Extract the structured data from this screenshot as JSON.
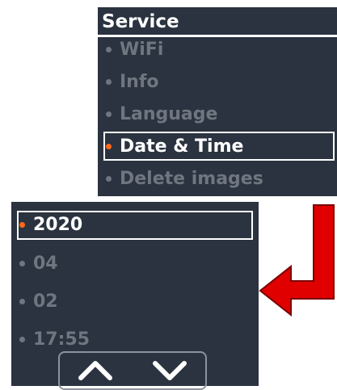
{
  "top_menu": {
    "title": "Service",
    "items": [
      {
        "label": "WiFi",
        "selected": false
      },
      {
        "label": "Info",
        "selected": false
      },
      {
        "label": "Language",
        "selected": false
      },
      {
        "label": "Date & Time",
        "selected": true
      },
      {
        "label": "Delete images",
        "selected": false
      }
    ]
  },
  "date_time_menu": {
    "items": [
      {
        "label": "2020",
        "selected": true
      },
      {
        "label": "04",
        "selected": false
      },
      {
        "label": "02",
        "selected": false
      },
      {
        "label": "17:55",
        "selected": false
      }
    ],
    "nav": {
      "up_icon": "chevron-up-icon",
      "down_icon": "chevron-down-icon"
    }
  },
  "colors": {
    "panel_bg": "#2b3340",
    "text_active": "#ffffff",
    "text_inactive": "#6f7680",
    "selected_dot": "#ff6a1a",
    "arrow": "#e00000"
  }
}
